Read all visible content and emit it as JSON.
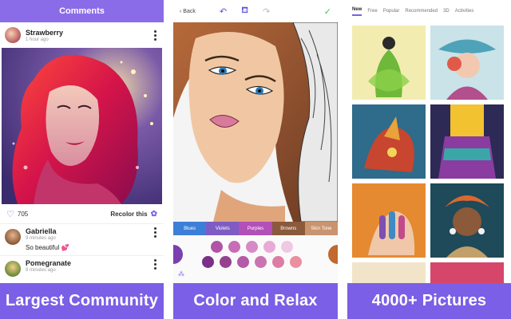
{
  "panel1": {
    "header_title": "Comments",
    "post": {
      "username": "Strawberry",
      "time": "1 hour ago"
    },
    "likes": "705",
    "recolor_label": "Recolor this",
    "comments": [
      {
        "username": "Gabriella",
        "time": "9 minutes ago",
        "text": "So beautiful"
      },
      {
        "username": "Pomegranate",
        "time": "9 minutes ago"
      }
    ],
    "banner": "Largest Community"
  },
  "panel2": {
    "back_label": "Back",
    "palette_tabs": [
      "Blues",
      "Violets",
      "Purples",
      "Browns",
      "Skin Tone"
    ],
    "selected_tab": "Purples",
    "banner": "Color and Relax"
  },
  "panel3": {
    "tabs": [
      "New",
      "Free",
      "Popular",
      "Recommended",
      "3D",
      "Activities"
    ],
    "selected_tab": "New",
    "banner": "4000+ Pictures"
  },
  "colors": {
    "accent": "#7b5fe6",
    "header": "#8a6ce8",
    "check": "#48b96b"
  }
}
